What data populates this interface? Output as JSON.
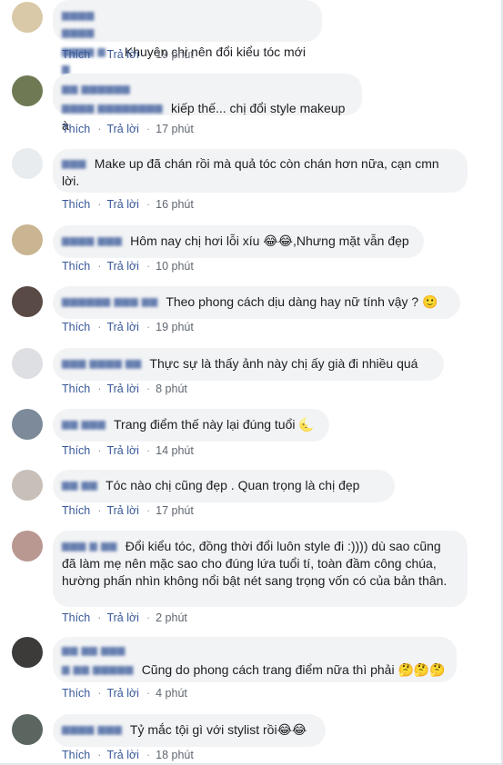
{
  "actions": {
    "like": "Thích",
    "reply": "Trả lời",
    "separator": "·"
  },
  "colors": {
    "link": "#385898",
    "bubble": "#f2f3f5",
    "text": "#1c1e21"
  },
  "comments": [
    {
      "name": "",
      "text": "Khuyên chị nên đổi kiểu tóc mới",
      "time": "19 phút",
      "avatar_color": "#d9c9a8"
    },
    {
      "name": "",
      "text": "kiếp thế... chị đổi style makeup à",
      "time": "17 phút",
      "avatar_color": "#6f7a55"
    },
    {
      "name": "",
      "text": "Make up đã chán rồi mà quả tóc còn chán hơn nữa, cạn cmn lời.",
      "time": "16 phút",
      "avatar_color": "#e9ecef"
    },
    {
      "name": "",
      "text": "Hôm nay chị hơi lỗi xíu 😂😂,Nhưng mặt vẫn đẹp",
      "time": "10 phút",
      "avatar_color": "#c9b592"
    },
    {
      "name": "",
      "text": "Theo phong cách dịu dàng hay nữ tính vậy ? 🙂",
      "time": "19 phút",
      "avatar_color": "#5a4a45"
    },
    {
      "name": "",
      "text": "Thực sự là thấy ảnh này chị ấy già đi nhiều quá",
      "time": "8 phút",
      "avatar_color": "#dddfe2"
    },
    {
      "name": "",
      "text": "Trang điểm thế này lại đúng tuổi 🌜",
      "time": "14 phút",
      "avatar_color": "#7c8a99"
    },
    {
      "name": "",
      "text": "Tóc nào chị cũng đẹp . Quan trọng là chị đẹp",
      "time": "17 phút",
      "avatar_color": "#c7bfb8"
    },
    {
      "name": "",
      "text": "Đổi kiểu tóc, đồng thời đổi luôn style đi :)))) dù sao cũng đã làm mẹ nên mặc sao cho đúng lứa tuổi tí, toàn đầm công chúa, hường phấn nhìn không nổi bật nét sang trọng vốn có của bản thân.",
      "time": "2 phút",
      "avatar_color": "#b89890"
    },
    {
      "name": "",
      "text": "Cũng do phong cách trang điểm nữa thì phải 🤔🤔🤔",
      "time": "4 phút",
      "avatar_color": "#3d3a3a"
    },
    {
      "name": "",
      "text": "Tỷ mắc tội gì với stylist rồi😂😂",
      "time": "18 phút",
      "avatar_color": "#5b6660"
    }
  ]
}
